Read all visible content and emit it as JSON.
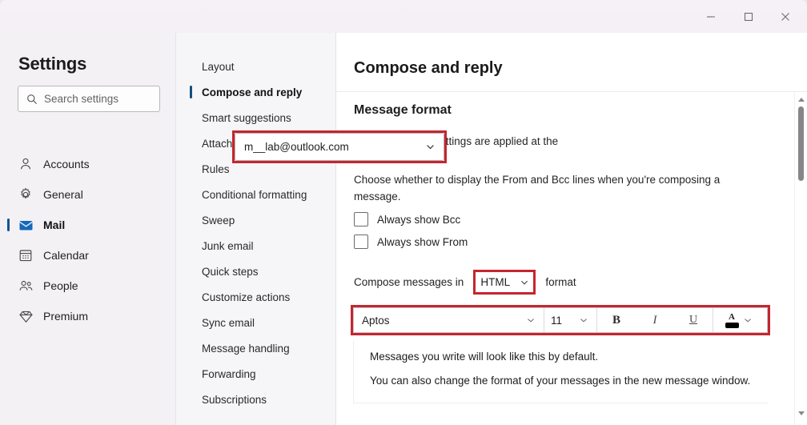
{
  "window": {
    "titlebar_color": "#f4f1f5",
    "controls": [
      {
        "name": "minimize",
        "glyph": "minimize-icon"
      },
      {
        "name": "maximize",
        "glyph": "maximize-icon"
      },
      {
        "name": "close",
        "glyph": "close-icon"
      }
    ]
  },
  "sidebar": {
    "title": "Settings",
    "search": {
      "placeholder": "Search settings",
      "value": "",
      "icon": "search-icon"
    },
    "items": [
      {
        "label": "Accounts",
        "icon": "person-icon",
        "selected": false
      },
      {
        "label": "General",
        "icon": "gear-icon",
        "selected": false
      },
      {
        "label": "Mail",
        "icon": "envelope-icon",
        "selected": true
      },
      {
        "label": "Calendar",
        "icon": "calendar-icon",
        "selected": false
      },
      {
        "label": "People",
        "icon": "people-icon",
        "selected": false
      },
      {
        "label": "Premium",
        "icon": "diamond-icon",
        "selected": false
      }
    ],
    "selection_indicator_color": "#14548f",
    "selected_icon_color": "#1668b8"
  },
  "nav": {
    "items": [
      {
        "label": "Layout",
        "selected": false
      },
      {
        "label": "Compose and reply",
        "selected": true
      },
      {
        "label": "Smart suggestions",
        "selected": false
      },
      {
        "label": "Attachments",
        "selected": false
      },
      {
        "label": "Rules",
        "selected": false
      },
      {
        "label": "Conditional formatting",
        "selected": false
      },
      {
        "label": "Sweep",
        "selected": false
      },
      {
        "label": "Junk email",
        "selected": false
      },
      {
        "label": "Quick steps",
        "selected": false
      },
      {
        "label": "Customize actions",
        "selected": false
      },
      {
        "label": "Sync email",
        "selected": false
      },
      {
        "label": "Message handling",
        "selected": false
      },
      {
        "label": "Forwarding",
        "selected": false
      },
      {
        "label": "Subscriptions",
        "selected": false
      }
    ],
    "selection_indicator_color": "#12507f"
  },
  "main": {
    "page_title": "Compose and reply",
    "section_title": "Message format",
    "account_description": "Message format settings are applied at the account level:",
    "account_select": {
      "value": "m__lab@outlook.com",
      "chevron": "chevron-down-icon",
      "highlighted": true
    },
    "bcc_description": "Choose whether to display the From and Bcc lines when you're composing a message.",
    "checkboxes": [
      {
        "label": "Always show Bcc",
        "checked": false
      },
      {
        "label": "Always show From",
        "checked": false
      }
    ],
    "compose_row": {
      "prefix": "Compose messages in",
      "format_value": "HTML",
      "suffix": "format",
      "chevron": "chevron-down-icon",
      "highlighted": true
    },
    "font_toolbar": {
      "highlighted": true,
      "font_name": "Aptos",
      "font_size": "11",
      "bold_label": "B",
      "italic_label": "I",
      "underline_label": "U",
      "font_color_label": "A",
      "font_color_swatch": "#000000",
      "chevron": "chevron-down-icon"
    },
    "preview": {
      "line1": "Messages you write will look like this by default.",
      "line2": "You can also change the format of your messages in the new message window."
    }
  },
  "scrollbar": {
    "up_arrow": "triangle-up-icon",
    "down_arrow": "triangle-down-icon",
    "thumb_color": "#888588"
  },
  "annotation": {
    "color": "#c4262e",
    "thickness_px": 3
  }
}
